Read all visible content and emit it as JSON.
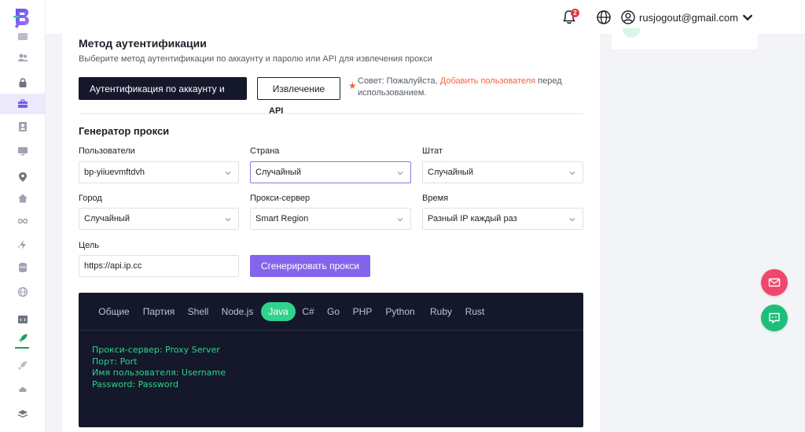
{
  "header": {
    "notification_count": "2",
    "user_email": "rusjogout@gmail.com"
  },
  "auth": {
    "title": "Метод аутентификации",
    "subtitle": "Выберите метод аутентификации по аккаунту и паролю или API для извлечения прокси",
    "account_button": "Аутентификация по аккаунту и",
    "extract_button": "Извлечение",
    "extract_button_suffix": "API",
    "tip_prefix": "Совет: Пожалуйста,",
    "tip_link": "Добавить пользователя",
    "tip_suffix": "перед использованием."
  },
  "generator": {
    "title": "Генератор прокси",
    "users_label": "Пользователи",
    "users_value": "bp-yiiuevmftdvh",
    "country_label": "Страна",
    "country_value": "Случайный",
    "state_label": "Штат",
    "state_value": "Случайный",
    "city_label": "Город",
    "city_value": "Случайный",
    "proxy_label": "Прокси-сервер",
    "proxy_value": "Smart Region",
    "time_label": "Время",
    "time_value": "Разный IP каждый раз",
    "target_label": "Цель",
    "target_value": "https://api.ip.cc",
    "generate_button": "Сгенерировать прокси"
  },
  "code": {
    "tabs": [
      "Общие",
      "Партия",
      "Shell",
      "Node.js",
      "Java",
      "C#",
      "Go",
      "PHP",
      "Python",
      "Ruby",
      "Rust"
    ],
    "active_tab": "Java",
    "lines": [
      "Прокси-сервер: Proxy Server",
      "Порт: Port",
      "Имя пользователя: Username",
      "Password: Password"
    ]
  },
  "colors": {
    "accent_purple": "#8265ec",
    "accent_green": "#2fd38b",
    "accent_orange": "#f06640",
    "code_bg": "#14182a"
  },
  "icons": {
    "sidebar": [
      "folder-icon",
      "users-icon",
      "lock-icon",
      "briefcase-icon",
      "contact-card-icon",
      "monitor-icon",
      "location-pin-icon",
      "home-icon",
      "infinity-icon",
      "lightning-icon",
      "database-icon",
      "globe-icon",
      "code-window-icon",
      "rocket-icon",
      "satellite-icon",
      "cloud-icon",
      "layers-icon"
    ],
    "header": [
      "bell-icon",
      "globe-icon",
      "user-circle-icon",
      "chevron-down-icon"
    ],
    "fab": [
      "mail-icon",
      "chat-icon"
    ]
  }
}
